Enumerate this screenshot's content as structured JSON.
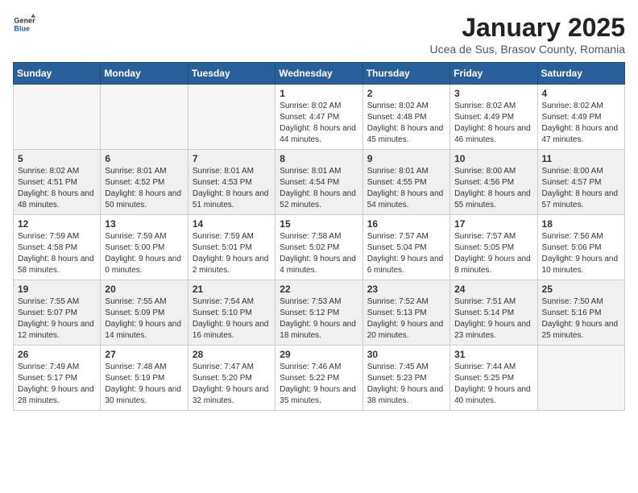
{
  "header": {
    "logo_general": "General",
    "logo_blue": "Blue",
    "month_title": "January 2025",
    "location": "Ucea de Sus, Brasov County, Romania"
  },
  "weekdays": [
    "Sunday",
    "Monday",
    "Tuesday",
    "Wednesday",
    "Thursday",
    "Friday",
    "Saturday"
  ],
  "weeks": [
    {
      "shaded": false,
      "days": [
        {
          "num": "",
          "info": ""
        },
        {
          "num": "",
          "info": ""
        },
        {
          "num": "",
          "info": ""
        },
        {
          "num": "1",
          "info": "Sunrise: 8:02 AM\nSunset: 4:47 PM\nDaylight: 8 hours and 44 minutes."
        },
        {
          "num": "2",
          "info": "Sunrise: 8:02 AM\nSunset: 4:48 PM\nDaylight: 8 hours and 45 minutes."
        },
        {
          "num": "3",
          "info": "Sunrise: 8:02 AM\nSunset: 4:49 PM\nDaylight: 8 hours and 46 minutes."
        },
        {
          "num": "4",
          "info": "Sunrise: 8:02 AM\nSunset: 4:49 PM\nDaylight: 8 hours and 47 minutes."
        }
      ]
    },
    {
      "shaded": true,
      "days": [
        {
          "num": "5",
          "info": "Sunrise: 8:02 AM\nSunset: 4:51 PM\nDaylight: 8 hours and 48 minutes."
        },
        {
          "num": "6",
          "info": "Sunrise: 8:01 AM\nSunset: 4:52 PM\nDaylight: 8 hours and 50 minutes."
        },
        {
          "num": "7",
          "info": "Sunrise: 8:01 AM\nSunset: 4:53 PM\nDaylight: 8 hours and 51 minutes."
        },
        {
          "num": "8",
          "info": "Sunrise: 8:01 AM\nSunset: 4:54 PM\nDaylight: 8 hours and 52 minutes."
        },
        {
          "num": "9",
          "info": "Sunrise: 8:01 AM\nSunset: 4:55 PM\nDaylight: 8 hours and 54 minutes."
        },
        {
          "num": "10",
          "info": "Sunrise: 8:00 AM\nSunset: 4:56 PM\nDaylight: 8 hours and 55 minutes."
        },
        {
          "num": "11",
          "info": "Sunrise: 8:00 AM\nSunset: 4:57 PM\nDaylight: 8 hours and 57 minutes."
        }
      ]
    },
    {
      "shaded": false,
      "days": [
        {
          "num": "12",
          "info": "Sunrise: 7:59 AM\nSunset: 4:58 PM\nDaylight: 8 hours and 58 minutes."
        },
        {
          "num": "13",
          "info": "Sunrise: 7:59 AM\nSunset: 5:00 PM\nDaylight: 9 hours and 0 minutes."
        },
        {
          "num": "14",
          "info": "Sunrise: 7:59 AM\nSunset: 5:01 PM\nDaylight: 9 hours and 2 minutes."
        },
        {
          "num": "15",
          "info": "Sunrise: 7:58 AM\nSunset: 5:02 PM\nDaylight: 9 hours and 4 minutes."
        },
        {
          "num": "16",
          "info": "Sunrise: 7:57 AM\nSunset: 5:04 PM\nDaylight: 9 hours and 6 minutes."
        },
        {
          "num": "17",
          "info": "Sunrise: 7:57 AM\nSunset: 5:05 PM\nDaylight: 9 hours and 8 minutes."
        },
        {
          "num": "18",
          "info": "Sunrise: 7:56 AM\nSunset: 5:06 PM\nDaylight: 9 hours and 10 minutes."
        }
      ]
    },
    {
      "shaded": true,
      "days": [
        {
          "num": "19",
          "info": "Sunrise: 7:55 AM\nSunset: 5:07 PM\nDaylight: 9 hours and 12 minutes."
        },
        {
          "num": "20",
          "info": "Sunrise: 7:55 AM\nSunset: 5:09 PM\nDaylight: 9 hours and 14 minutes."
        },
        {
          "num": "21",
          "info": "Sunrise: 7:54 AM\nSunset: 5:10 PM\nDaylight: 9 hours and 16 minutes."
        },
        {
          "num": "22",
          "info": "Sunrise: 7:53 AM\nSunset: 5:12 PM\nDaylight: 9 hours and 18 minutes."
        },
        {
          "num": "23",
          "info": "Sunrise: 7:52 AM\nSunset: 5:13 PM\nDaylight: 9 hours and 20 minutes."
        },
        {
          "num": "24",
          "info": "Sunrise: 7:51 AM\nSunset: 5:14 PM\nDaylight: 9 hours and 23 minutes."
        },
        {
          "num": "25",
          "info": "Sunrise: 7:50 AM\nSunset: 5:16 PM\nDaylight: 9 hours and 25 minutes."
        }
      ]
    },
    {
      "shaded": false,
      "days": [
        {
          "num": "26",
          "info": "Sunrise: 7:49 AM\nSunset: 5:17 PM\nDaylight: 9 hours and 28 minutes."
        },
        {
          "num": "27",
          "info": "Sunrise: 7:48 AM\nSunset: 5:19 PM\nDaylight: 9 hours and 30 minutes."
        },
        {
          "num": "28",
          "info": "Sunrise: 7:47 AM\nSunset: 5:20 PM\nDaylight: 9 hours and 32 minutes."
        },
        {
          "num": "29",
          "info": "Sunrise: 7:46 AM\nSunset: 5:22 PM\nDaylight: 9 hours and 35 minutes."
        },
        {
          "num": "30",
          "info": "Sunrise: 7:45 AM\nSunset: 5:23 PM\nDaylight: 9 hours and 38 minutes."
        },
        {
          "num": "31",
          "info": "Sunrise: 7:44 AM\nSunset: 5:25 PM\nDaylight: 9 hours and 40 minutes."
        },
        {
          "num": "",
          "info": ""
        }
      ]
    }
  ]
}
